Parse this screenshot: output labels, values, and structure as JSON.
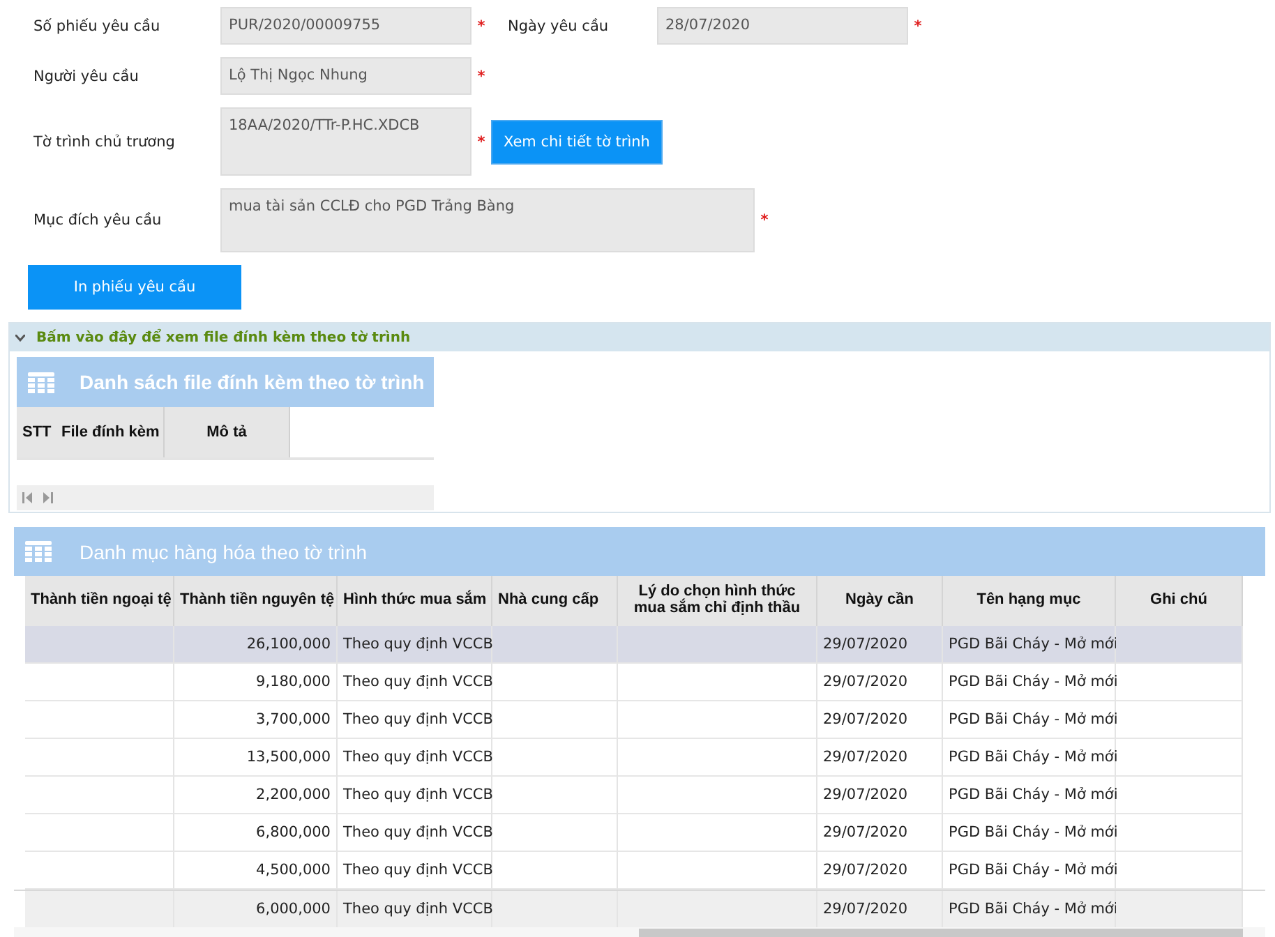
{
  "request_form": {
    "rows": [
      {
        "fields": [
          {
            "label": "Số phiếu yêu cầu",
            "value": "PUR/2020/00009755",
            "required_mark": "*",
            "kind": "line"
          },
          {
            "label": "Ngày yêu cầu",
            "value": "28/07/2020",
            "required_mark": "*",
            "kind": "line"
          }
        ]
      },
      {
        "fields": [
          {
            "label": "Người yêu cầu",
            "value": "Lộ Thị Ngọc Nhung",
            "required_mark": "*",
            "kind": "line"
          }
        ]
      },
      {
        "fields": [
          {
            "label": "Tờ trình chủ trương",
            "value": "18AA/2020/TTr-P.HC.XDCB",
            "required_mark": "*",
            "kind": "tall"
          }
        ],
        "button": "Xem chi tiết tờ trình"
      },
      {
        "fields": [
          {
            "label": "Mục đích yêu cầu",
            "value": "mua tài sản CCLĐ cho PGD Trảng Bàng",
            "required_mark": "*",
            "kind": "area"
          }
        ]
      }
    ],
    "print_button": "In phiếu yêu cầu"
  },
  "attachments": {
    "toggle": "Bấm vào đây để xem file đính kèm theo tờ trình",
    "expanded": true,
    "title": "Danh sách file đính kèm theo tờ trình",
    "columns": [
      "STT",
      "File đính kèm",
      "Mô tả"
    ]
  },
  "goods": {
    "title": "Danh mục hàng hóa theo tờ trình",
    "columns": [
      "Thành tiền ngoại tệ",
      "Thành tiền nguyên tệ",
      "Hình thức mua sắm",
      "Nhà cung cấp",
      "Lý do chọn hình thức mua sắm chỉ định thầu",
      "Ngày cần",
      "Tên hạng mục",
      "Ghi chú"
    ],
    "rows": [
      {
        "cells": [
          null,
          "26,100,000",
          "Theo quy định VCCB",
          null,
          null,
          "29/07/2020",
          "PGD Bãi Cháy - Mở mới",
          null
        ],
        "selected": true,
        "hovered": false
      },
      {
        "cells": [
          null,
          "9,180,000",
          "Theo quy định VCCB",
          null,
          null,
          "29/07/2020",
          "PGD Bãi Cháy - Mở mới",
          null
        ],
        "selected": false,
        "hovered": false
      },
      {
        "cells": [
          null,
          "3,700,000",
          "Theo quy định VCCB",
          null,
          null,
          "29/07/2020",
          "PGD Bãi Cháy - Mở mới",
          null
        ],
        "selected": false,
        "hovered": false
      },
      {
        "cells": [
          null,
          "13,500,000",
          "Theo quy định VCCB",
          null,
          null,
          "29/07/2020",
          "PGD Bãi Cháy - Mở mới",
          null
        ],
        "selected": false,
        "hovered": false
      },
      {
        "cells": [
          null,
          "2,200,000",
          "Theo quy định VCCB",
          null,
          null,
          "29/07/2020",
          "PGD Bãi Cháy - Mở mới",
          null
        ],
        "selected": false,
        "hovered": false
      },
      {
        "cells": [
          null,
          "6,800,000",
          "Theo quy định VCCB",
          null,
          null,
          "29/07/2020",
          "PGD Bãi Cháy - Mở mới",
          null
        ],
        "selected": false,
        "hovered": false
      },
      {
        "cells": [
          null,
          "4,500,000",
          "Theo quy định VCCB",
          null,
          null,
          "29/07/2020",
          "PGD Bãi Cháy - Mở mới",
          null
        ],
        "selected": false,
        "hovered": false
      },
      {
        "cells": [
          null,
          "6,000,000",
          "Theo quy định VCCB",
          null,
          null,
          "29/07/2020",
          "PGD Bãi Cháy - Mở mới",
          null
        ],
        "selected": false,
        "hovered": true
      }
    ]
  }
}
